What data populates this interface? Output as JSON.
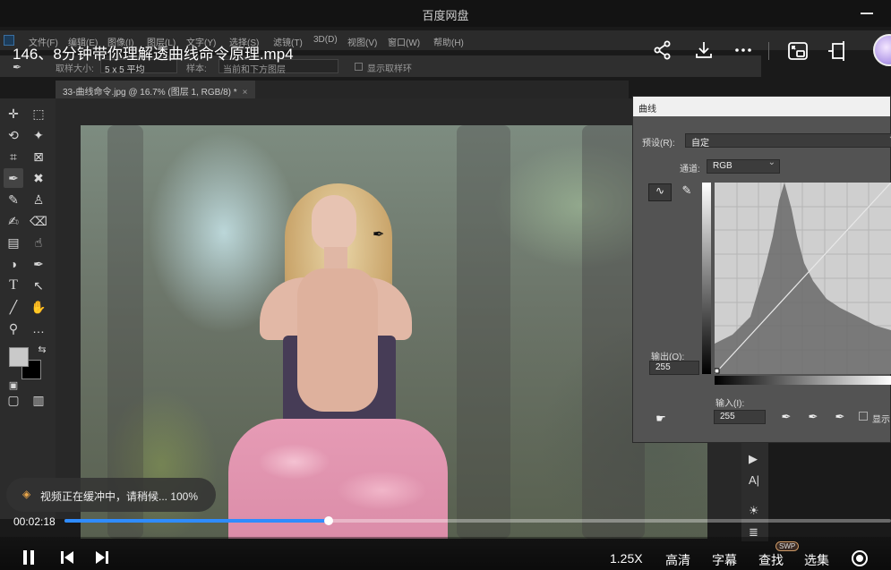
{
  "app": {
    "title": "百度网盘"
  },
  "video": {
    "title": "146、8分钟带你理解透曲线命令原理.mp4",
    "buffer_message": "视频正在缓冲中，请稍候... 100%",
    "current_time": "00:02:18",
    "progress_fraction": 0.32,
    "speed_label": "1.25X",
    "quality_label": "高清",
    "subtitle_label": "字幕",
    "search_label": "查找",
    "search_badge": "SWP",
    "select_label": "选集",
    "accent_color": "#2f8cff"
  },
  "top_controls": {
    "share": "share-icon",
    "download": "download-icon",
    "more": "more-icon",
    "pip": "picture-in-picture-icon",
    "float": "float-window-icon"
  },
  "photoshop": {
    "menu": [
      "文件(F)",
      "编辑(E)",
      "图像(I)",
      "图层(L)",
      "文字(Y)",
      "选择(S)",
      "滤镜(T)",
      "3D(D)",
      "视图(V)",
      "窗口(W)",
      "帮助(H)"
    ],
    "options": {
      "sample_size_label": "取样大小:",
      "sample_size_value": "5 x 5 平均",
      "sample_label": "样本:",
      "sample_value": "当前和下方图层",
      "show_ring": "显示取样环"
    },
    "doc_tab": "33-曲线命令.jpg @ 16.7% (图层 1, RGB/8) *",
    "doc_tab_close": "×"
  },
  "curves_dialog": {
    "title": "曲线",
    "preset_label": "预设(R):",
    "preset_value": "自定",
    "channel_label": "通道:",
    "channel_value": "RGB",
    "output_label": "输出(O):",
    "output_value": "255",
    "input_label": "输入(I):",
    "input_value": "255",
    "show_clipping": "显示"
  },
  "right_panel": {
    "text_label": "A|"
  }
}
